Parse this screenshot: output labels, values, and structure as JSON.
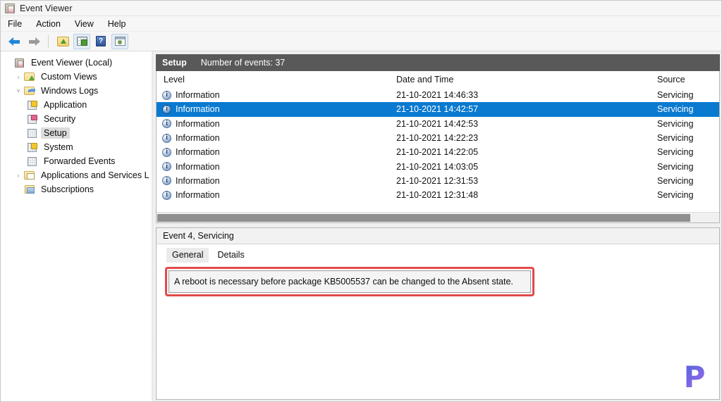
{
  "window": {
    "title": "Event Viewer",
    "icon": "event-viewer-icon"
  },
  "menubar": {
    "items": [
      {
        "label": "File"
      },
      {
        "label": "Action"
      },
      {
        "label": "View"
      },
      {
        "label": "Help"
      }
    ]
  },
  "toolbar": {
    "buttons": [
      {
        "name": "back-button",
        "icon": "back-arrow-icon"
      },
      {
        "name": "forward-button",
        "icon": "forward-arrow-icon"
      },
      {
        "name": "up-one-level-button",
        "icon": "folder-up-icon"
      },
      {
        "name": "show-hide-console-tree-button",
        "icon": "grid-icon"
      },
      {
        "name": "help-button",
        "icon": "help-icon"
      },
      {
        "name": "properties-button",
        "icon": "properties-icon"
      }
    ]
  },
  "tree": {
    "nodes": [
      {
        "label": "Event Viewer (Local)",
        "icon": "event-viewer-icon",
        "indent": 1,
        "twisty": "",
        "selected": false
      },
      {
        "label": "Custom Views",
        "icon": "custom-views-folder-icon",
        "indent": 2,
        "twisty": "›",
        "selected": false
      },
      {
        "label": "Windows Logs",
        "icon": "windows-logs-folder-icon",
        "indent": 2,
        "twisty": "˅",
        "selected": false
      },
      {
        "label": "Application",
        "icon": "application-log-icon",
        "indent": 3,
        "twisty": "",
        "selected": false
      },
      {
        "label": "Security",
        "icon": "security-log-icon",
        "indent": 3,
        "twisty": "",
        "selected": false
      },
      {
        "label": "Setup",
        "icon": "setup-log-icon",
        "indent": 3,
        "twisty": "",
        "selected": true
      },
      {
        "label": "System",
        "icon": "system-log-icon",
        "indent": 3,
        "twisty": "",
        "selected": false
      },
      {
        "label": "Forwarded Events",
        "icon": "forwarded-events-log-icon",
        "indent": 3,
        "twisty": "",
        "selected": false
      },
      {
        "label": "Applications and Services Log",
        "icon": "app-services-logs-folder-icon",
        "indent": 2,
        "twisty": "›",
        "selected": false
      },
      {
        "label": "Subscriptions",
        "icon": "subscriptions-icon",
        "indent": 2,
        "twisty": "",
        "selected": false
      }
    ]
  },
  "list": {
    "header": {
      "log_name": "Setup",
      "count_text": "Number of events: 37"
    },
    "columns": {
      "level": "Level",
      "date_time": "Date and Time",
      "source": "Source"
    },
    "rows": [
      {
        "level": "Information",
        "date_time": "21-10-2021 14:46:33",
        "source": "Servicing",
        "selected": false
      },
      {
        "level": "Information",
        "date_time": "21-10-2021 14:42:57",
        "source": "Servicing",
        "selected": true
      },
      {
        "level": "Information",
        "date_time": "21-10-2021 14:42:53",
        "source": "Servicing",
        "selected": false
      },
      {
        "level": "Information",
        "date_time": "21-10-2021 14:22:23",
        "source": "Servicing",
        "selected": false
      },
      {
        "level": "Information",
        "date_time": "21-10-2021 14:22:05",
        "source": "Servicing",
        "selected": false
      },
      {
        "level": "Information",
        "date_time": "21-10-2021 14:03:05",
        "source": "Servicing",
        "selected": false
      },
      {
        "level": "Information",
        "date_time": "21-10-2021 12:31:53",
        "source": "Servicing",
        "selected": false
      },
      {
        "level": "Information",
        "date_time": "21-10-2021 12:31:48",
        "source": "Servicing",
        "selected": false
      }
    ]
  },
  "detail": {
    "title": "Event 4, Servicing",
    "tabs": [
      {
        "label": "General",
        "active": true
      },
      {
        "label": "Details",
        "active": false
      }
    ],
    "message": "A reboot is necessary before package KB5005537 can be changed to the Absent state."
  },
  "watermark": {
    "letter": "P"
  },
  "colors": {
    "selection_blue": "#0a7ad1",
    "header_bar_gray": "#595959",
    "highlight_red": "#e24a4a",
    "tree_selected_gray": "#dcdcdc"
  }
}
